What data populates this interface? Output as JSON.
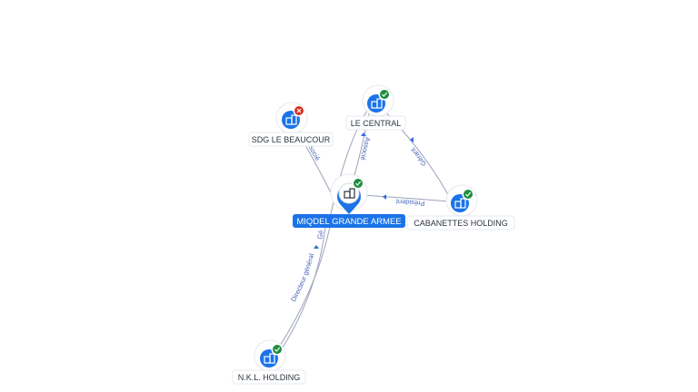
{
  "nodes": {
    "center": {
      "label": "MIQDEL GRANDE ARMEE",
      "status": "active"
    },
    "le_central": {
      "label": "LE CENTRAL",
      "status": "active"
    },
    "sdg": {
      "label": "SDG LE BEAUCOUR",
      "status": "closed"
    },
    "cabanettes": {
      "label": "CABANETTES HOLDING",
      "status": "active"
    },
    "nkl": {
      "label": "N.K.L. HOLDING",
      "status": "active"
    }
  },
  "edges": {
    "sdg_center": "Associé",
    "central_center": "Associé",
    "cabanettes_central": "Gérant",
    "cabanettes_center": "Président",
    "nkl_center": "Directeur général",
    "nkl_center_short": "Gé"
  },
  "colors": {
    "accent": "#1a73e8",
    "status_active": "#1e8e3e",
    "status_closed": "#d93025",
    "edge": "#9aa3b8",
    "edge_label": "#4a66b8"
  },
  "icons": {
    "company": "building-icon",
    "active": "check-icon",
    "closed": "cross-icon"
  }
}
